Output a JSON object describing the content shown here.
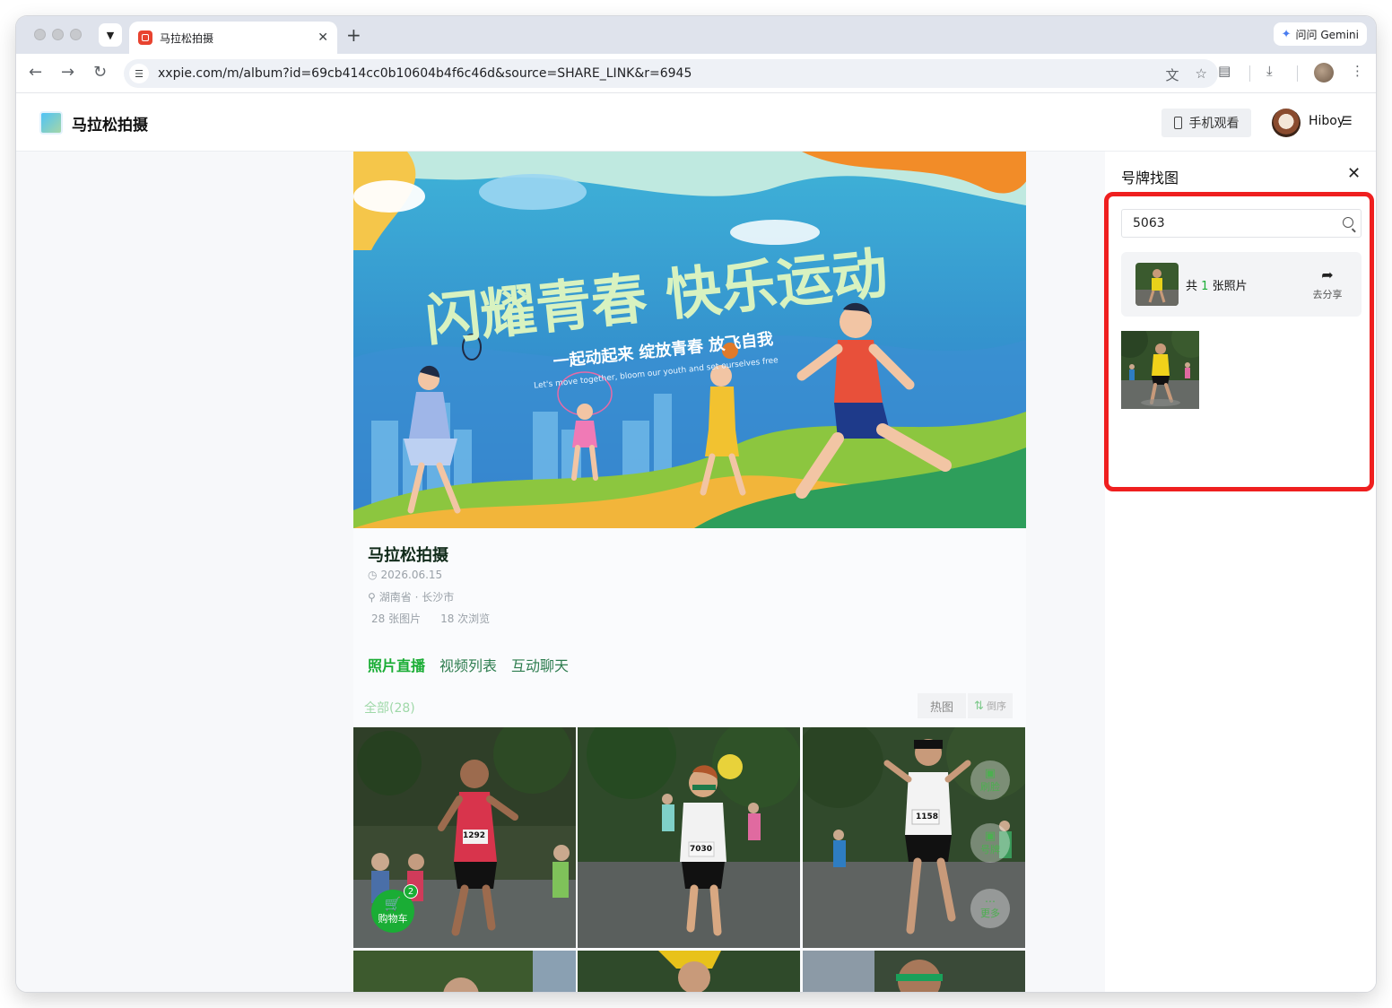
{
  "browser": {
    "tab_title": "马拉松拍摄",
    "gemini_label": "问问 Gemini",
    "url": "xxpie.com/m/album?id=69cb414cc0b10604b4f6c46d&source=SHARE_LINK&r=6945",
    "icons": [
      "back-icon",
      "forward-icon",
      "reload-icon",
      "site-settings-icon",
      "translate-icon",
      "bookmark-star-icon",
      "extensions-icon",
      "download-icon",
      "more-icon"
    ]
  },
  "header": {
    "site_name": "马拉松拍摄",
    "mobile_view_label": "手机观看",
    "user_name": "Hiboy"
  },
  "banner": {
    "headline": "闪耀青春 快乐运动",
    "subline": "一起动起来 绽放青春 放飞自我",
    "english": "Let's move together, bloom our youth and set ourselves free"
  },
  "album": {
    "title": "马拉松拍摄",
    "date": "2026.06.15",
    "location": "湖南省 · 长沙市",
    "photo_count": "28 张图片",
    "view_count": "18 次浏览"
  },
  "tabs": [
    {
      "label": "照片直播",
      "active": true
    },
    {
      "label": "视频列表",
      "active": false
    },
    {
      "label": "互动聊天",
      "active": false
    }
  ],
  "filter": {
    "all_label": "全部(28)",
    "hot_label": "热图",
    "sort_label": "倒序"
  },
  "photos": [
    {
      "bib": "1292"
    },
    {
      "bib": "7030"
    },
    {
      "bib": "1158"
    }
  ],
  "cart": {
    "label": "购物车",
    "count": "2"
  },
  "fabs": {
    "face": "刷脸",
    "bib": "号牌",
    "more": "更多"
  },
  "side_panel": {
    "title": "号牌找图",
    "search_value": "5063",
    "result_prefix": "共",
    "result_count": "1",
    "result_suffix": "张照片",
    "share_label": "去分享"
  },
  "colors": {
    "accent": "#1aad35",
    "highlight": "#ef1f1f",
    "banner_sky": "#2f8fd0"
  }
}
